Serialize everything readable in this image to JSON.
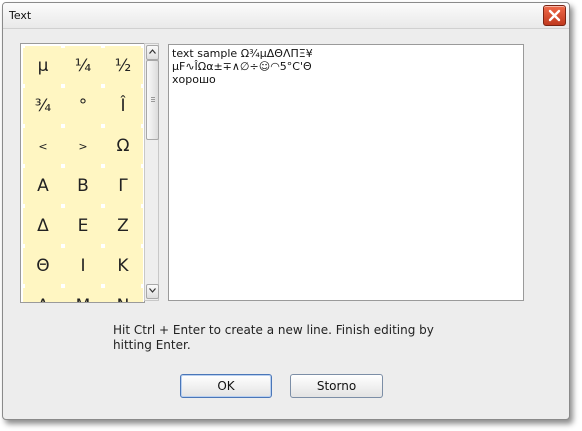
{
  "window": {
    "title": "Text"
  },
  "palette": {
    "chars": [
      "μ",
      "¼",
      "½",
      "¾",
      "°",
      "Î",
      "<",
      ">",
      "Ω",
      "Α",
      "Β",
      "Γ",
      "Δ",
      "Ε",
      "Ζ",
      "Θ",
      "Ι",
      "Κ",
      "Λ",
      "Μ",
      "Ν"
    ]
  },
  "editor": {
    "lines": [
      "text sample Ω¾μΔΘΛΠΞ¥",
      "μF∿ÎΩα±∓∧∅÷☺◠5°C'Θ",
      "хорошо"
    ]
  },
  "hint": "Hit Ctrl + Enter to create a new line. Finish editing by hitting Enter.",
  "buttons": {
    "ok": "OK",
    "cancel": "Storno"
  }
}
